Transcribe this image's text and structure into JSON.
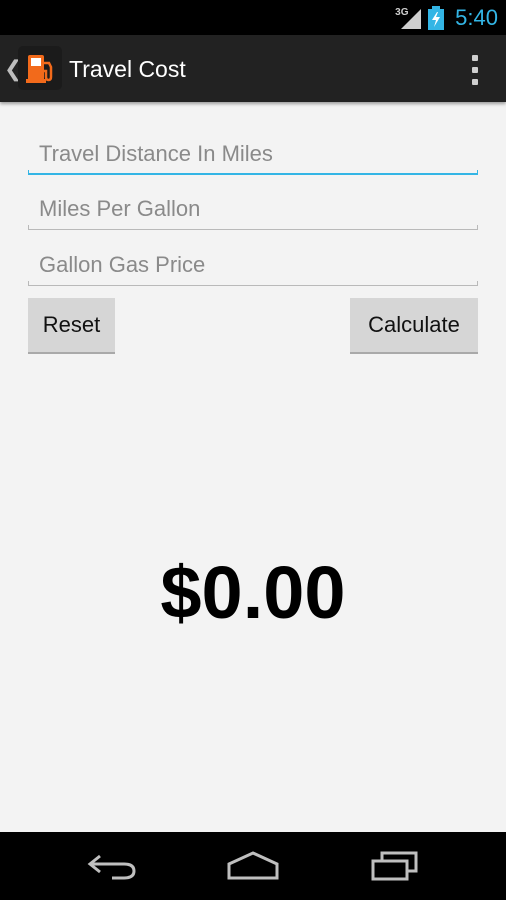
{
  "status_bar": {
    "network_type": "3G",
    "time": "5:40",
    "signal_icon": "signal-icon",
    "battery_icon": "battery-charging-icon"
  },
  "action_bar": {
    "title": "Travel Cost",
    "app_icon": "fuel-pump-icon",
    "up_icon": "chevron-left-icon",
    "overflow_icon": "overflow-menu-icon"
  },
  "form": {
    "distance": {
      "placeholder": "Travel Distance In Miles",
      "value": ""
    },
    "mpg": {
      "placeholder": "Miles Per Gallon",
      "value": ""
    },
    "price": {
      "placeholder": "Gallon Gas Price",
      "value": ""
    },
    "reset_label": "Reset",
    "calculate_label": "Calculate"
  },
  "result": {
    "cost": "$0.00"
  },
  "nav_bar": {
    "back_icon": "back-icon",
    "home_icon": "home-icon",
    "recents_icon": "recents-icon"
  },
  "colors": {
    "accent": "#33b5e5",
    "action_bar": "#222222",
    "background": "#f3f3f3",
    "button": "#d6d6d6",
    "app_icon_orange": "#f26a1b"
  }
}
